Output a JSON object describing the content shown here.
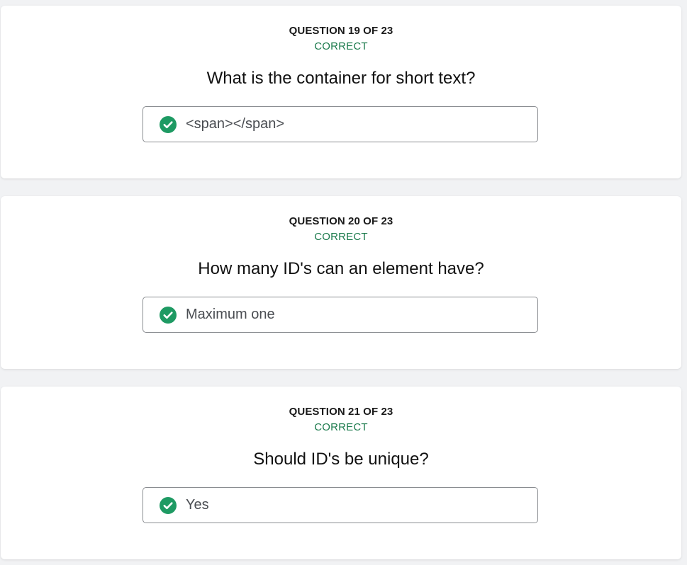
{
  "colors": {
    "background": "#f1f2f4",
    "card": "#ffffff",
    "correct_text": "#1b7a4c",
    "check_fill": "#1e9a63",
    "answer_border": "#8a8d91"
  },
  "questions": [
    {
      "counter": "QUESTION 19 OF 23",
      "status": "CORRECT",
      "question": "What is the container for short text?",
      "answer": "<span></span>",
      "answer_icon": "check-circle-icon"
    },
    {
      "counter": "QUESTION 20 OF 23",
      "status": "CORRECT",
      "question": "How many ID's can an element have?",
      "answer": "Maximum one",
      "answer_icon": "check-circle-icon"
    },
    {
      "counter": "QUESTION 21 OF 23",
      "status": "CORRECT",
      "question": "Should ID's be unique?",
      "answer": "Yes",
      "answer_icon": "check-circle-icon"
    }
  ]
}
